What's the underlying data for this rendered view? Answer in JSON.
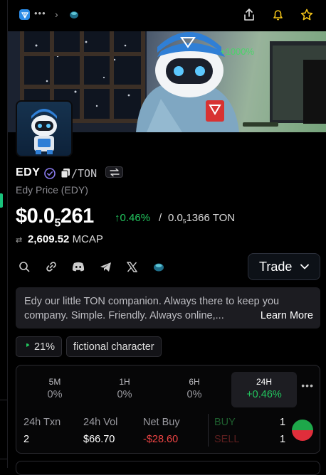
{
  "token": {
    "symbol": "EDY",
    "pair_quote": "/TON",
    "full_name": "Edy Price (EDY)",
    "price_prefix": "$0.0",
    "price_zeros": "5",
    "price_digits": "261",
    "change_24h": "0.46%",
    "separator": "/",
    "ton_prefix": "0.0",
    "ton_zeros": "5",
    "ton_digits": "1366 TON",
    "mcap_value": "2,609.52",
    "mcap_label": "MCAP"
  },
  "actions": {
    "trade_label": "Trade"
  },
  "description": {
    "text": "Edy our little TON companion. Always there to keep you company. Simple. Friendly. Always online,...",
    "learn_more": "Learn More"
  },
  "tags": [
    "21%",
    "fictional character"
  ],
  "timeframes": [
    {
      "label": "5M",
      "value": "0%"
    },
    {
      "label": "1H",
      "value": "0%"
    },
    {
      "label": "6H",
      "value": "0%"
    },
    {
      "label": "24H",
      "value": "+0.46%"
    }
  ],
  "stats": {
    "txn_label": "24h Txn",
    "txn_value": "2",
    "vol_label": "24h Vol",
    "vol_value": "$66.70",
    "netbuy_label": "Net Buy",
    "netbuy_value": "-$28.60",
    "buy_label": "BUY",
    "buy_count": "1",
    "sell_label": "SELL",
    "sell_count": "1"
  },
  "banner": {
    "overlay_text": "+1000%"
  },
  "colors": {
    "positive": "#22c55e",
    "negative": "#ef4444",
    "accent": "#2b8be6"
  }
}
